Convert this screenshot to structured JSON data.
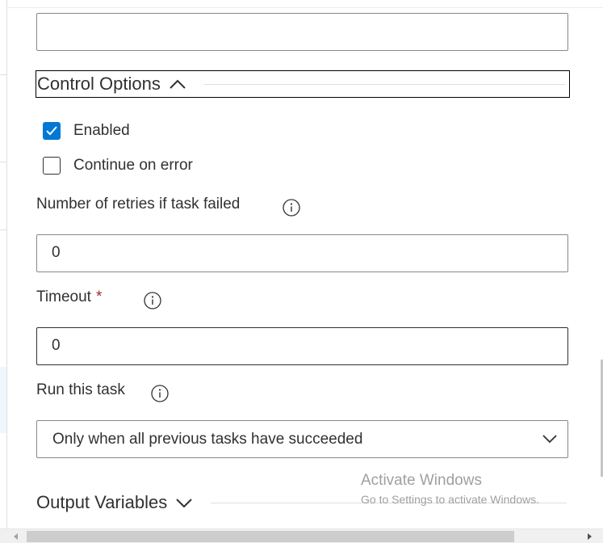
{
  "control_options": {
    "title": "Control Options",
    "enabled": {
      "label": "Enabled",
      "checked": true
    },
    "continue_on_error": {
      "label": "Continue on error",
      "checked": false
    },
    "retries": {
      "label": "Number of retries if task failed",
      "value": "0"
    },
    "timeout": {
      "label": "Timeout",
      "required_marker": "*",
      "value": "0"
    },
    "run_this_task": {
      "label": "Run this task",
      "selected": "Only when all previous tasks have succeeded"
    }
  },
  "output_variables": {
    "title": "Output Variables"
  },
  "watermark": {
    "title": "Activate Windows",
    "subtitle": "Go to Settings to activate Windows."
  },
  "colors": {
    "accent": "#0078d4",
    "required": "#a4262c",
    "border": "#8a8886",
    "text": "#323130"
  },
  "icons": [
    "chevron-up-icon",
    "chevron-down-icon",
    "info-icon",
    "checkmark-icon",
    "scroll-left-icon",
    "scroll-right-icon"
  ]
}
